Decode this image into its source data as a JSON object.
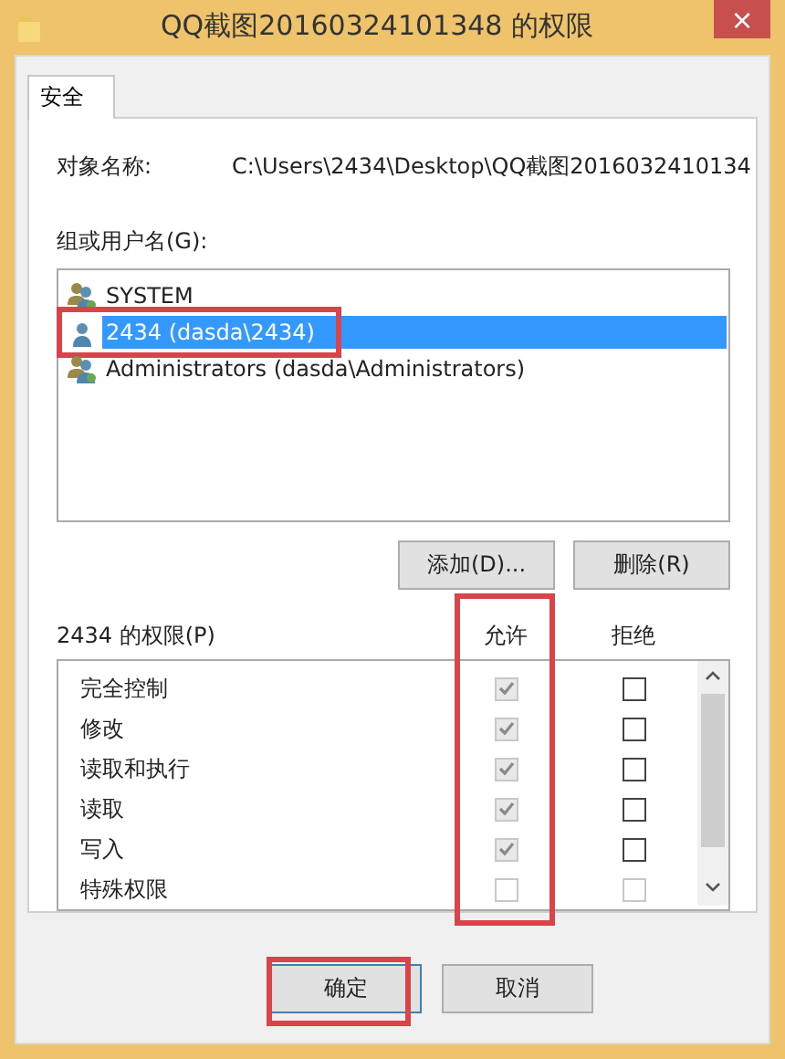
{
  "window": {
    "title": "QQ截图20160324101348 的权限",
    "close": "×"
  },
  "tabs": [
    {
      "label": "安全",
      "selected": true
    }
  ],
  "object_name": {
    "label": "对象名称:",
    "value": "C:\\Users\\2434\\Desktop\\QQ截图2016032410134"
  },
  "groups": {
    "label": "组或用户名(G):",
    "items": [
      {
        "name": "SYSTEM",
        "kind": "group",
        "selected": false,
        "highlighted": false
      },
      {
        "name": "2434 (dasda\\2434)",
        "kind": "user",
        "selected": true,
        "highlighted": true
      },
      {
        "name": "Administrators (dasda\\Administrators)",
        "kind": "group",
        "selected": false,
        "highlighted": false
      }
    ],
    "buttons": [
      "添加(D)...",
      "删除(R)"
    ]
  },
  "permissions": {
    "label": "2434 的权限(P)",
    "columns": [
      {
        "label": "允许",
        "highlighted": true
      },
      {
        "label": "拒绝",
        "highlighted": false
      }
    ],
    "rows": [
      {
        "name": "完全控制",
        "allow": {
          "checked": true,
          "disabled": true
        },
        "deny": {
          "checked": false,
          "disabled": false
        }
      },
      {
        "name": "修改",
        "allow": {
          "checked": true,
          "disabled": true
        },
        "deny": {
          "checked": false,
          "disabled": false
        }
      },
      {
        "name": "读取和执行",
        "allow": {
          "checked": true,
          "disabled": true
        },
        "deny": {
          "checked": false,
          "disabled": false
        }
      },
      {
        "name": "读取",
        "allow": {
          "checked": true,
          "disabled": true
        },
        "deny": {
          "checked": false,
          "disabled": false
        }
      },
      {
        "name": "写入",
        "allow": {
          "checked": true,
          "disabled": true
        },
        "deny": {
          "checked": false,
          "disabled": false
        }
      },
      {
        "name": "特殊权限",
        "allow": {
          "checked": false,
          "disabled": true
        },
        "deny": {
          "checked": false,
          "disabled": true
        }
      }
    ]
  },
  "footer": [
    {
      "label": "确定",
      "default": true,
      "highlighted": true
    },
    {
      "label": "取消",
      "default": false,
      "highlighted": false
    }
  ]
}
